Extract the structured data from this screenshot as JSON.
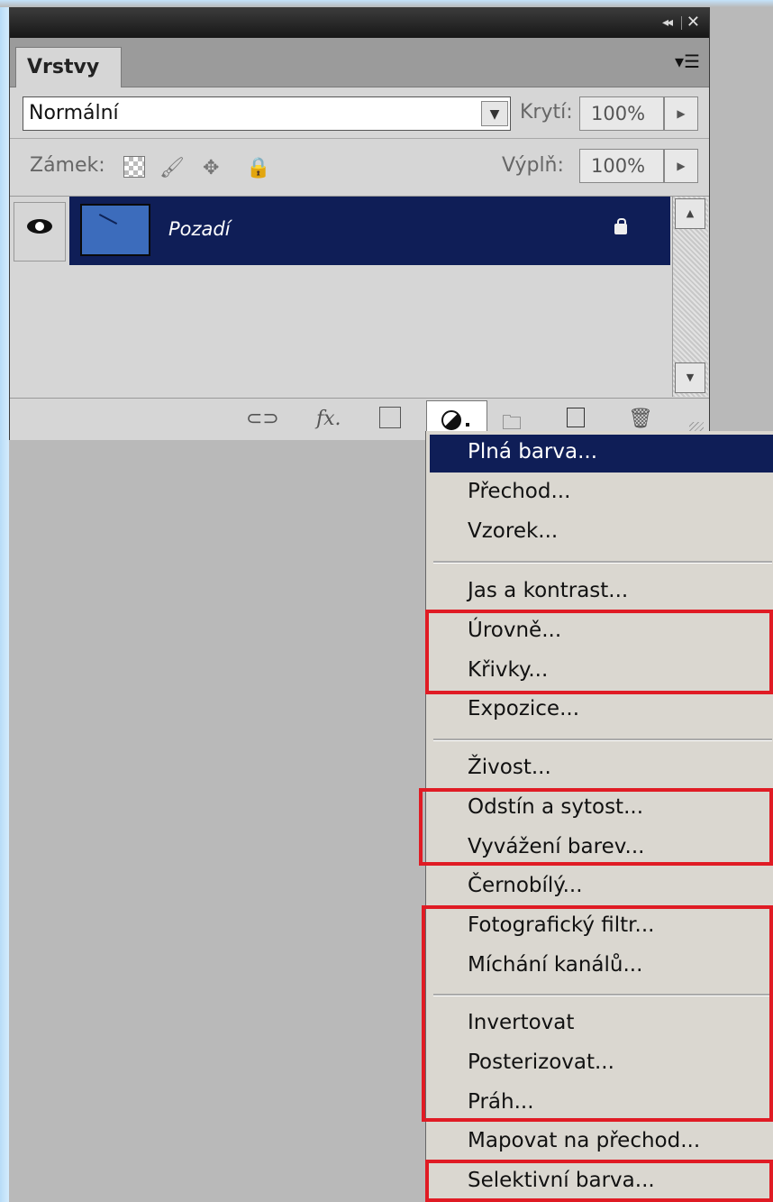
{
  "panel": {
    "tab_label": "Vrstvy",
    "blend_mode": "Normální",
    "opacity_label": "Krytí:",
    "opacity_value": "100%",
    "lock_label": "Zámek:",
    "fill_label": "Výplň:",
    "fill_value": "100%",
    "layers": [
      {
        "name": "Pozadí",
        "visible": true,
        "locked": true,
        "selected": true
      }
    ]
  },
  "adjustment_menu": {
    "items": [
      {
        "label": "Plná barva...",
        "highlighted": true
      },
      {
        "label": "Přechod..."
      },
      {
        "label": "Vzorek..."
      },
      {
        "separator": true
      },
      {
        "label": "Jas a kontrast..."
      },
      {
        "label": "Úrovně..."
      },
      {
        "label": "Křivky..."
      },
      {
        "label": "Expozice..."
      },
      {
        "separator": true
      },
      {
        "label": "Živost..."
      },
      {
        "label": "Odstín a sytost..."
      },
      {
        "label": "Vyvážení barev..."
      },
      {
        "label": "Černobílý..."
      },
      {
        "label": "Fotografický filtr..."
      },
      {
        "label": "Míchání kanálů..."
      },
      {
        "separator": true
      },
      {
        "label": "Invertovat"
      },
      {
        "label": "Posterizovat..."
      },
      {
        "label": "Práh..."
      },
      {
        "label": "Mapovat na přechod..."
      },
      {
        "label": "Selektivní barva..."
      }
    ]
  },
  "colors": {
    "selection": "#0f1e57",
    "annotation_red": "#e01b24"
  }
}
